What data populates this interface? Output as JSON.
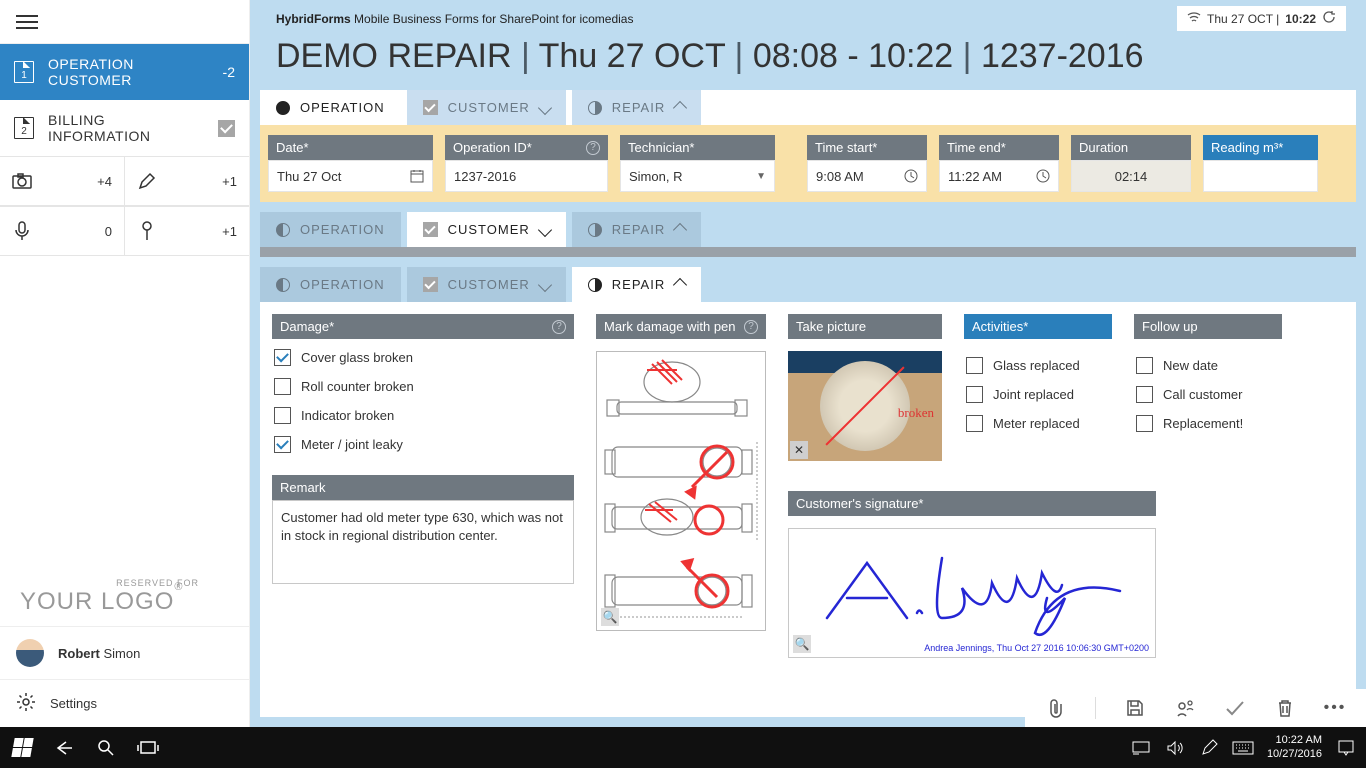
{
  "header": {
    "brand_bold": "HybridForms",
    "brand_rest": " Mobile Business Forms for SharePoint for icomedias",
    "clock_date": "Thu 27 OCT | ",
    "clock_time": "10:22",
    "title_part1": "DEMO REPAIR ",
    "title_sep1": "| ",
    "title_part2": "Thu 27 OCT ",
    "title_sep2": "| ",
    "title_part3": "08:08 - 10:22 ",
    "title_sep3": "| ",
    "title_part4": "1237-2016"
  },
  "sidebar": {
    "nav1": {
      "label": "OPERATION CUSTOMER",
      "badge": "-2",
      "doc": "1"
    },
    "nav2": {
      "label": "BILLING INFORMATION",
      "doc": "2"
    },
    "mini": {
      "photos": "+4",
      "pen": "+1",
      "mic": "0",
      "pin": "+1"
    },
    "reserved": "RESERVED FOR",
    "logo": "YOUR LOGO",
    "reg": "®",
    "user_first": "Robert",
    "user_last": " Simon",
    "settings": "Settings"
  },
  "tabs": {
    "operation": "OPERATION",
    "customer": "CUSTOMER",
    "repair": "REPAIR"
  },
  "op_fields": {
    "date": {
      "hdr": "Date*",
      "val": "Thu 27 Oct"
    },
    "opid": {
      "hdr": "Operation ID*",
      "val": "1237-2016"
    },
    "tech": {
      "hdr": "Technician*",
      "val": "Simon, R"
    },
    "tstart": {
      "hdr": "Time start*",
      "val": "9:08 AM"
    },
    "tend": {
      "hdr": "Time end*",
      "val": "11:22 AM"
    },
    "dur": {
      "hdr": "Duration",
      "val": "02:14"
    },
    "read": {
      "hdr": "Reading m³*",
      "val": ""
    }
  },
  "repair": {
    "damage_hdr": "Damage*",
    "damage": {
      "cover": {
        "label": "Cover glass broken",
        "checked": true
      },
      "roll": {
        "label": "Roll counter broken",
        "checked": false
      },
      "indic": {
        "label": "Indicator broken",
        "checked": false
      },
      "meter": {
        "label": "Meter / joint leaky",
        "checked": true
      }
    },
    "remark_hdr": "Remark",
    "remark_text": "Customer had old meter type 630, which was not in stock in regional distribution center.",
    "sketch_hdr": "Mark damage with pen",
    "photo_hdr": "Take picture",
    "photo_annot": "broken",
    "activities_hdr": "Activities*",
    "activities": {
      "glass": {
        "label": "Glass replaced"
      },
      "joint": {
        "label": "Joint replaced"
      },
      "meter": {
        "label": "Meter replaced"
      }
    },
    "followup_hdr": "Follow up",
    "followup": {
      "date": {
        "label": "New date"
      },
      "call": {
        "label": "Call customer"
      },
      "repl": {
        "label": "Replacement!"
      }
    },
    "sig_hdr": "Customer's signature*",
    "sig_caption": "Andrea Jennings, Thu Oct 27 2016 10:06:30 GMT+0200"
  },
  "taskbar": {
    "time": "10:22 AM",
    "date": "10/27/2016"
  }
}
